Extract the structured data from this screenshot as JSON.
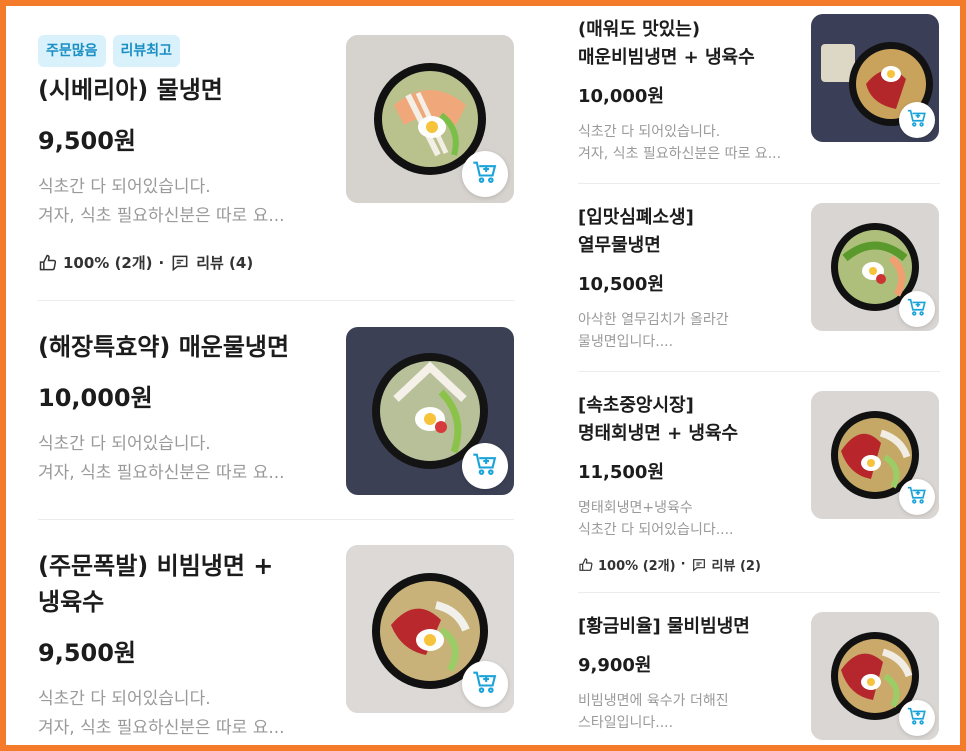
{
  "left": {
    "items": [
      {
        "badges": [
          "주문많음",
          "리뷰최고"
        ],
        "name": "(시베리아) 물냉면",
        "price": "9,500원",
        "desc1": "식초간 다 되어있습니다.",
        "desc2": "겨자, 식초 필요하신분은 따로 요...",
        "likes": "100% (2개)",
        "sep": "·",
        "reviews": "리뷰 (4)"
      },
      {
        "name": "(해장특효약) 매운물냉면",
        "price": "10,000원",
        "desc1": "식초간 다 되어있습니다.",
        "desc2": "겨자, 식초 필요하신분은 따로 요..."
      },
      {
        "name1": "(주문폭발) 비빔냉면 +",
        "name2": "냉육수",
        "price": "9,500원",
        "desc1": "식초간 다 되어있습니다.",
        "desc2": "겨자, 식초 필요하신분은 따로 요..."
      }
    ]
  },
  "right": {
    "items": [
      {
        "name1": "(매워도 맛있는)",
        "name2": "매운비빔냉면 + 냉육수",
        "price": "10,000원",
        "desc1": "식초간 다 되어있습니다.",
        "desc2": "겨자, 식초 필요하신분은 따로 요..."
      },
      {
        "name1": "[입맛심폐소생]",
        "name2": "열무물냉면",
        "price": "10,500원",
        "desc1": "아삭한 열무김치가 올라간",
        "desc2": "물냉면입니다...."
      },
      {
        "name1": "[속초중앙시장]",
        "name2": "명태회냉면 + 냉육수",
        "price": "11,500원",
        "desc1": "명태회냉면+냉육수",
        "desc2": "식초간 다 되어있습니다....",
        "likes": "100% (2개)",
        "sep": "·",
        "reviews": "리뷰 (2)"
      },
      {
        "name": "[황금비율] 물비빔냉면",
        "price": "9,900원",
        "desc1": "비빔냉면에 육수가 더해진",
        "desc2": "스타일입니다...."
      }
    ]
  },
  "icons": {
    "cart": "cart-add-icon",
    "thumb": "thumbs-up-icon",
    "review": "review-bubble-icon"
  },
  "colors": {
    "frame": "#f47b2a",
    "accent": "#1aa3d9",
    "badge_bg": "#d8f1fb"
  }
}
